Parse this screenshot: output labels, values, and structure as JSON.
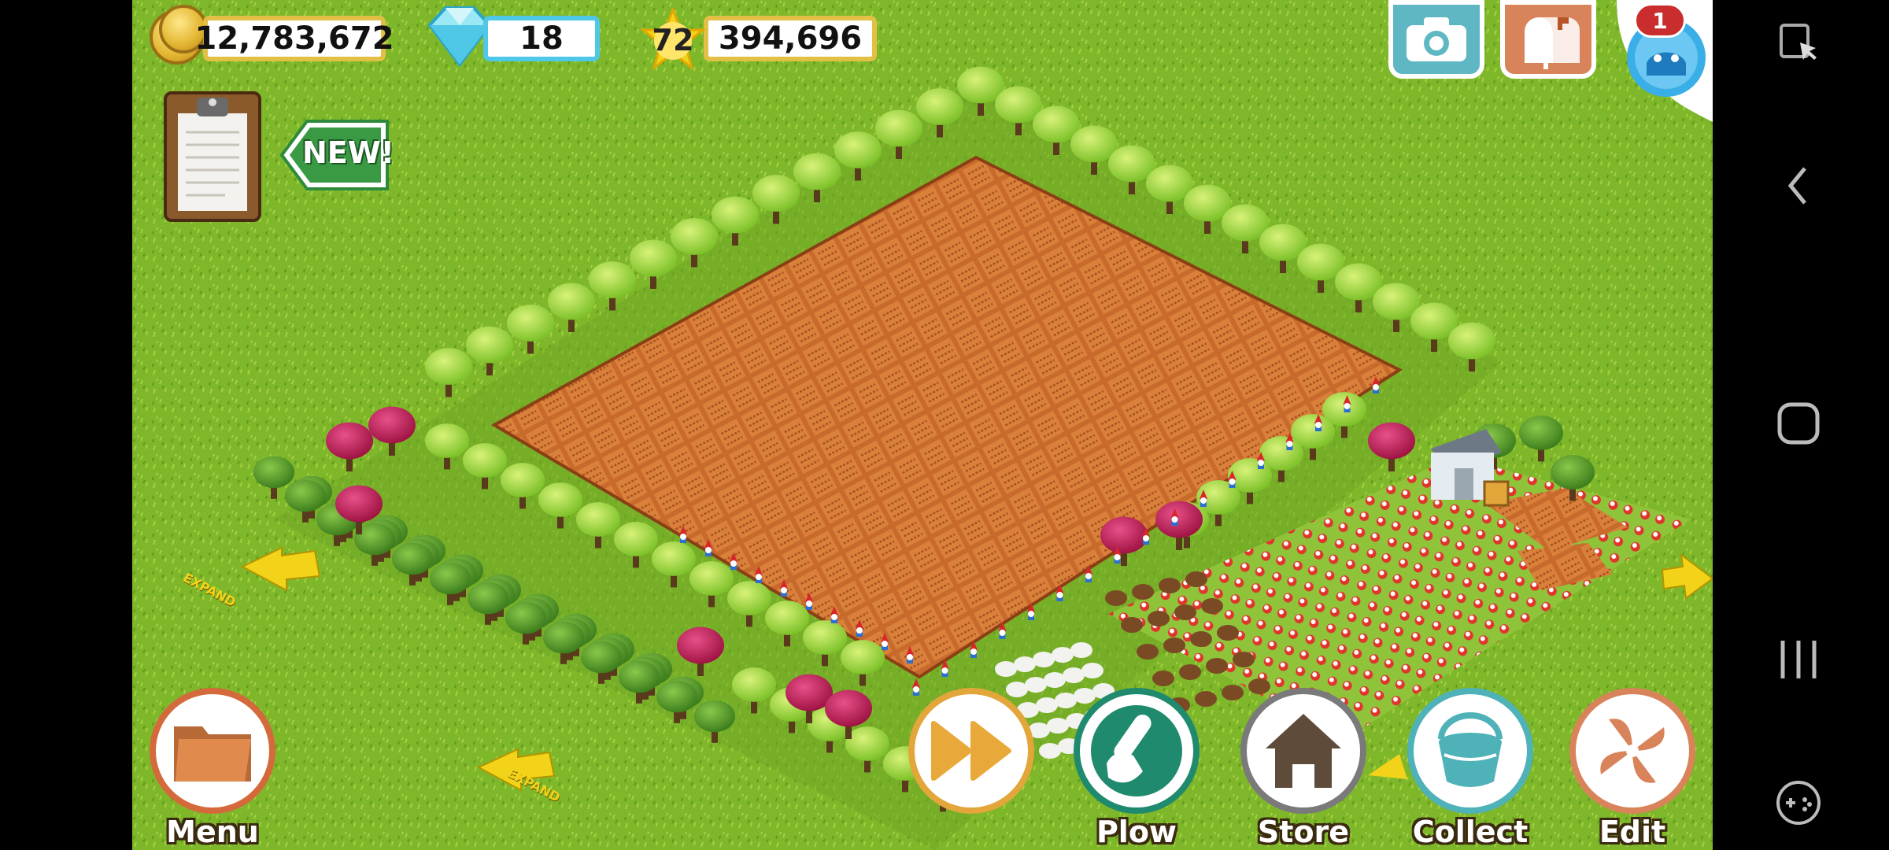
{
  "hud": {
    "coins": "12,783,672",
    "gems": "18",
    "level": "72",
    "xp": "394,696"
  },
  "top_buttons": {
    "mail_badge": "1"
  },
  "new_badge": "NEW!",
  "expand_label": "EXPAND",
  "bottom_bar": {
    "menu": "Menu",
    "plow": "Plow",
    "store": "Store",
    "collect": "Collect",
    "edit": "Edit"
  },
  "colors": {
    "grass": "#7fb72a",
    "soil": "#c6662a",
    "hud_border": "#e2c046",
    "gem_border": "#4fc7e6",
    "button_ring": "#d46a3c",
    "plow_green": "#1f8a6e"
  },
  "icons": {
    "coins": "coin-stack-icon",
    "gems": "diamond-icon",
    "level": "star-icon",
    "quest": "clipboard-icon",
    "camera": "camera-icon",
    "mail": "mailbox-icon",
    "friend": "friend-avatar-icon",
    "menu": "folder-icon",
    "fast_forward": "fast-forward-icon",
    "plow": "hoe-icon",
    "store": "house-icon",
    "collect": "bucket-icon",
    "edit": "pinwheel-icon"
  }
}
